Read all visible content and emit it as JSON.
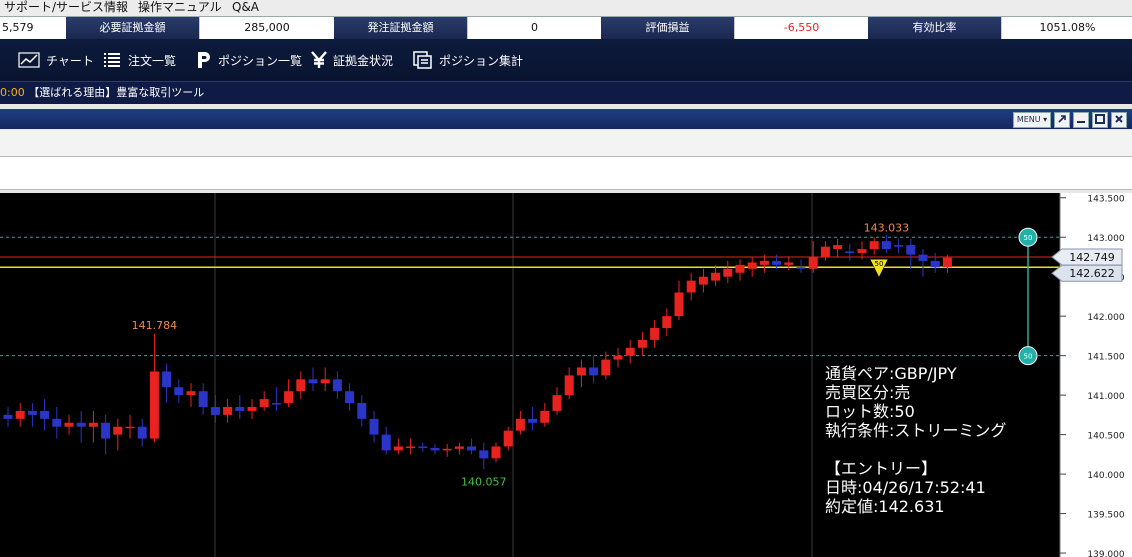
{
  "menu": {
    "items": [
      "サポート/サービス情報",
      "操作マニュアル",
      "Q&A"
    ]
  },
  "status": {
    "first_value": "5,579",
    "required_margin": {
      "label": "必要証拠金額",
      "value": "285,000"
    },
    "order_margin": {
      "label": "発注証拠金額",
      "value": "0"
    },
    "unrealized_pl": {
      "label": "評価損益",
      "value": "-6,550"
    },
    "margin_ratio": {
      "label": "有効比率",
      "value": "1051.08%"
    }
  },
  "toolbar": {
    "chart": "チャート",
    "order_list": "注文一覧",
    "position_list": "ポジション一覧",
    "margin_status": "証拠金状況",
    "position_summary": "ポジション集計"
  },
  "ticker": {
    "time": "0:00",
    "text": "【選ばれる理由】豊富な取引ツール"
  },
  "window": {
    "menu_label": "MENU"
  },
  "colors": {
    "up": "#e8231f",
    "down": "#2b35c9",
    "background": "#000000",
    "accent": "#f3b31b",
    "loss": "#e8231f"
  },
  "chart_data": {
    "type": "candlestick",
    "y_ticks": [
      "143.500",
      "143.000",
      "142.500",
      "142.000",
      "141.500",
      "141.000",
      "140.500",
      "140.000",
      "139.500",
      "139.000"
    ],
    "ylim": [
      138.95,
      143.56
    ],
    "high_label": "143.033",
    "peak_label": "141.784",
    "low_label": "140.057",
    "bid": "142.749",
    "current": "142.622",
    "marker_lots": "50",
    "tp_line": 143.0,
    "sl_line": 141.5,
    "entry_line": 142.62,
    "candles": [
      [
        140.75,
        140.85,
        140.6,
        140.7
      ],
      [
        140.7,
        140.9,
        140.6,
        140.8
      ],
      [
        140.8,
        140.9,
        140.6,
        140.75
      ],
      [
        140.8,
        140.95,
        140.55,
        140.7
      ],
      [
        140.7,
        140.85,
        140.45,
        140.6
      ],
      [
        140.6,
        140.75,
        140.5,
        140.65
      ],
      [
        140.65,
        140.8,
        140.4,
        140.6
      ],
      [
        140.6,
        140.8,
        140.4,
        140.65
      ],
      [
        140.65,
        140.75,
        140.25,
        140.45
      ],
      [
        140.5,
        140.7,
        140.3,
        140.6
      ],
      [
        140.6,
        140.75,
        140.45,
        140.6
      ],
      [
        140.6,
        140.7,
        140.35,
        140.45
      ],
      [
        140.45,
        141.78,
        140.4,
        141.3
      ],
      [
        141.3,
        141.4,
        140.9,
        141.1
      ],
      [
        141.1,
        141.2,
        140.9,
        141.0
      ],
      [
        141.0,
        141.15,
        140.85,
        141.05
      ],
      [
        141.05,
        141.15,
        140.75,
        140.85
      ],
      [
        140.85,
        141.0,
        140.65,
        140.75
      ],
      [
        140.75,
        140.95,
        140.65,
        140.85
      ],
      [
        140.85,
        141.0,
        140.7,
        140.8
      ],
      [
        140.8,
        140.95,
        140.7,
        140.85
      ],
      [
        140.85,
        141.05,
        140.8,
        140.95
      ],
      [
        140.9,
        141.1,
        140.8,
        140.88
      ],
      [
        140.9,
        141.2,
        140.85,
        141.05
      ],
      [
        141.05,
        141.3,
        140.95,
        141.2
      ],
      [
        141.2,
        141.35,
        141.05,
        141.15
      ],
      [
        141.15,
        141.35,
        141.05,
        141.2
      ],
      [
        141.2,
        141.3,
        140.95,
        141.05
      ],
      [
        141.05,
        141.15,
        140.8,
        140.9
      ],
      [
        140.9,
        141.0,
        140.6,
        140.7
      ],
      [
        140.7,
        140.8,
        140.4,
        140.5
      ],
      [
        140.5,
        140.6,
        140.25,
        140.3
      ],
      [
        140.3,
        140.45,
        140.25,
        140.35
      ],
      [
        140.35,
        140.45,
        140.25,
        140.35
      ],
      [
        140.35,
        140.4,
        140.28,
        140.33
      ],
      [
        140.33,
        140.38,
        140.25,
        140.3
      ],
      [
        140.3,
        140.38,
        140.22,
        140.32
      ],
      [
        140.32,
        140.4,
        140.25,
        140.35
      ],
      [
        140.35,
        140.45,
        140.25,
        140.3
      ],
      [
        140.3,
        140.4,
        140.06,
        140.2
      ],
      [
        140.2,
        140.4,
        140.15,
        140.35
      ],
      [
        140.35,
        140.6,
        140.3,
        140.55
      ],
      [
        140.55,
        140.8,
        140.5,
        140.7
      ],
      [
        140.7,
        140.85,
        140.55,
        140.65
      ],
      [
        140.65,
        140.9,
        140.6,
        140.8
      ],
      [
        140.8,
        141.1,
        140.75,
        141.0
      ],
      [
        141.0,
        141.35,
        140.95,
        141.25
      ],
      [
        141.25,
        141.45,
        141.1,
        141.35
      ],
      [
        141.35,
        141.5,
        141.15,
        141.25
      ],
      [
        141.25,
        141.55,
        141.2,
        141.45
      ],
      [
        141.45,
        141.6,
        141.35,
        141.5
      ],
      [
        141.5,
        141.7,
        141.4,
        141.6
      ],
      [
        141.6,
        141.8,
        141.5,
        141.7
      ],
      [
        141.7,
        141.95,
        141.6,
        141.85
      ],
      [
        141.85,
        142.1,
        141.75,
        142.0
      ],
      [
        142.0,
        142.45,
        141.95,
        142.3
      ],
      [
        142.3,
        142.55,
        142.2,
        142.45
      ],
      [
        142.4,
        142.6,
        142.3,
        142.5
      ],
      [
        142.45,
        142.65,
        142.38,
        142.55
      ],
      [
        142.5,
        142.7,
        142.42,
        142.6
      ],
      [
        142.55,
        142.72,
        142.45,
        142.65
      ],
      [
        142.6,
        142.75,
        142.5,
        142.68
      ],
      [
        142.65,
        142.78,
        142.55,
        142.7
      ],
      [
        142.7,
        142.78,
        142.6,
        142.65
      ],
      [
        142.65,
        142.76,
        142.58,
        142.68
      ],
      [
        142.62,
        142.72,
        142.55,
        142.6
      ],
      [
        142.6,
        142.95,
        142.55,
        142.75
      ],
      [
        142.75,
        142.95,
        142.7,
        142.88
      ],
      [
        142.85,
        142.98,
        142.75,
        142.9
      ],
      [
        142.82,
        142.92,
        142.7,
        142.8
      ],
      [
        142.8,
        142.95,
        142.72,
        142.85
      ],
      [
        142.85,
        143.0,
        142.78,
        142.95
      ],
      [
        142.95,
        143.03,
        142.8,
        142.85
      ],
      [
        142.9,
        142.98,
        142.8,
        142.88
      ],
      [
        142.9,
        142.98,
        142.6,
        142.78
      ],
      [
        142.78,
        142.85,
        142.5,
        142.7
      ],
      [
        142.7,
        142.8,
        142.55,
        142.62
      ],
      [
        142.62,
        142.78,
        142.55,
        142.74
      ]
    ]
  },
  "order_info": {
    "pair": "通貨ペア:GBP/JPY",
    "side": "売買区分:売",
    "lots": "ロット数:50",
    "condition": "執行条件:ストリーミング",
    "entry_title": "【エントリー】",
    "datetime": "日時:04/26/17:52:41",
    "price": "約定値:142.631"
  }
}
